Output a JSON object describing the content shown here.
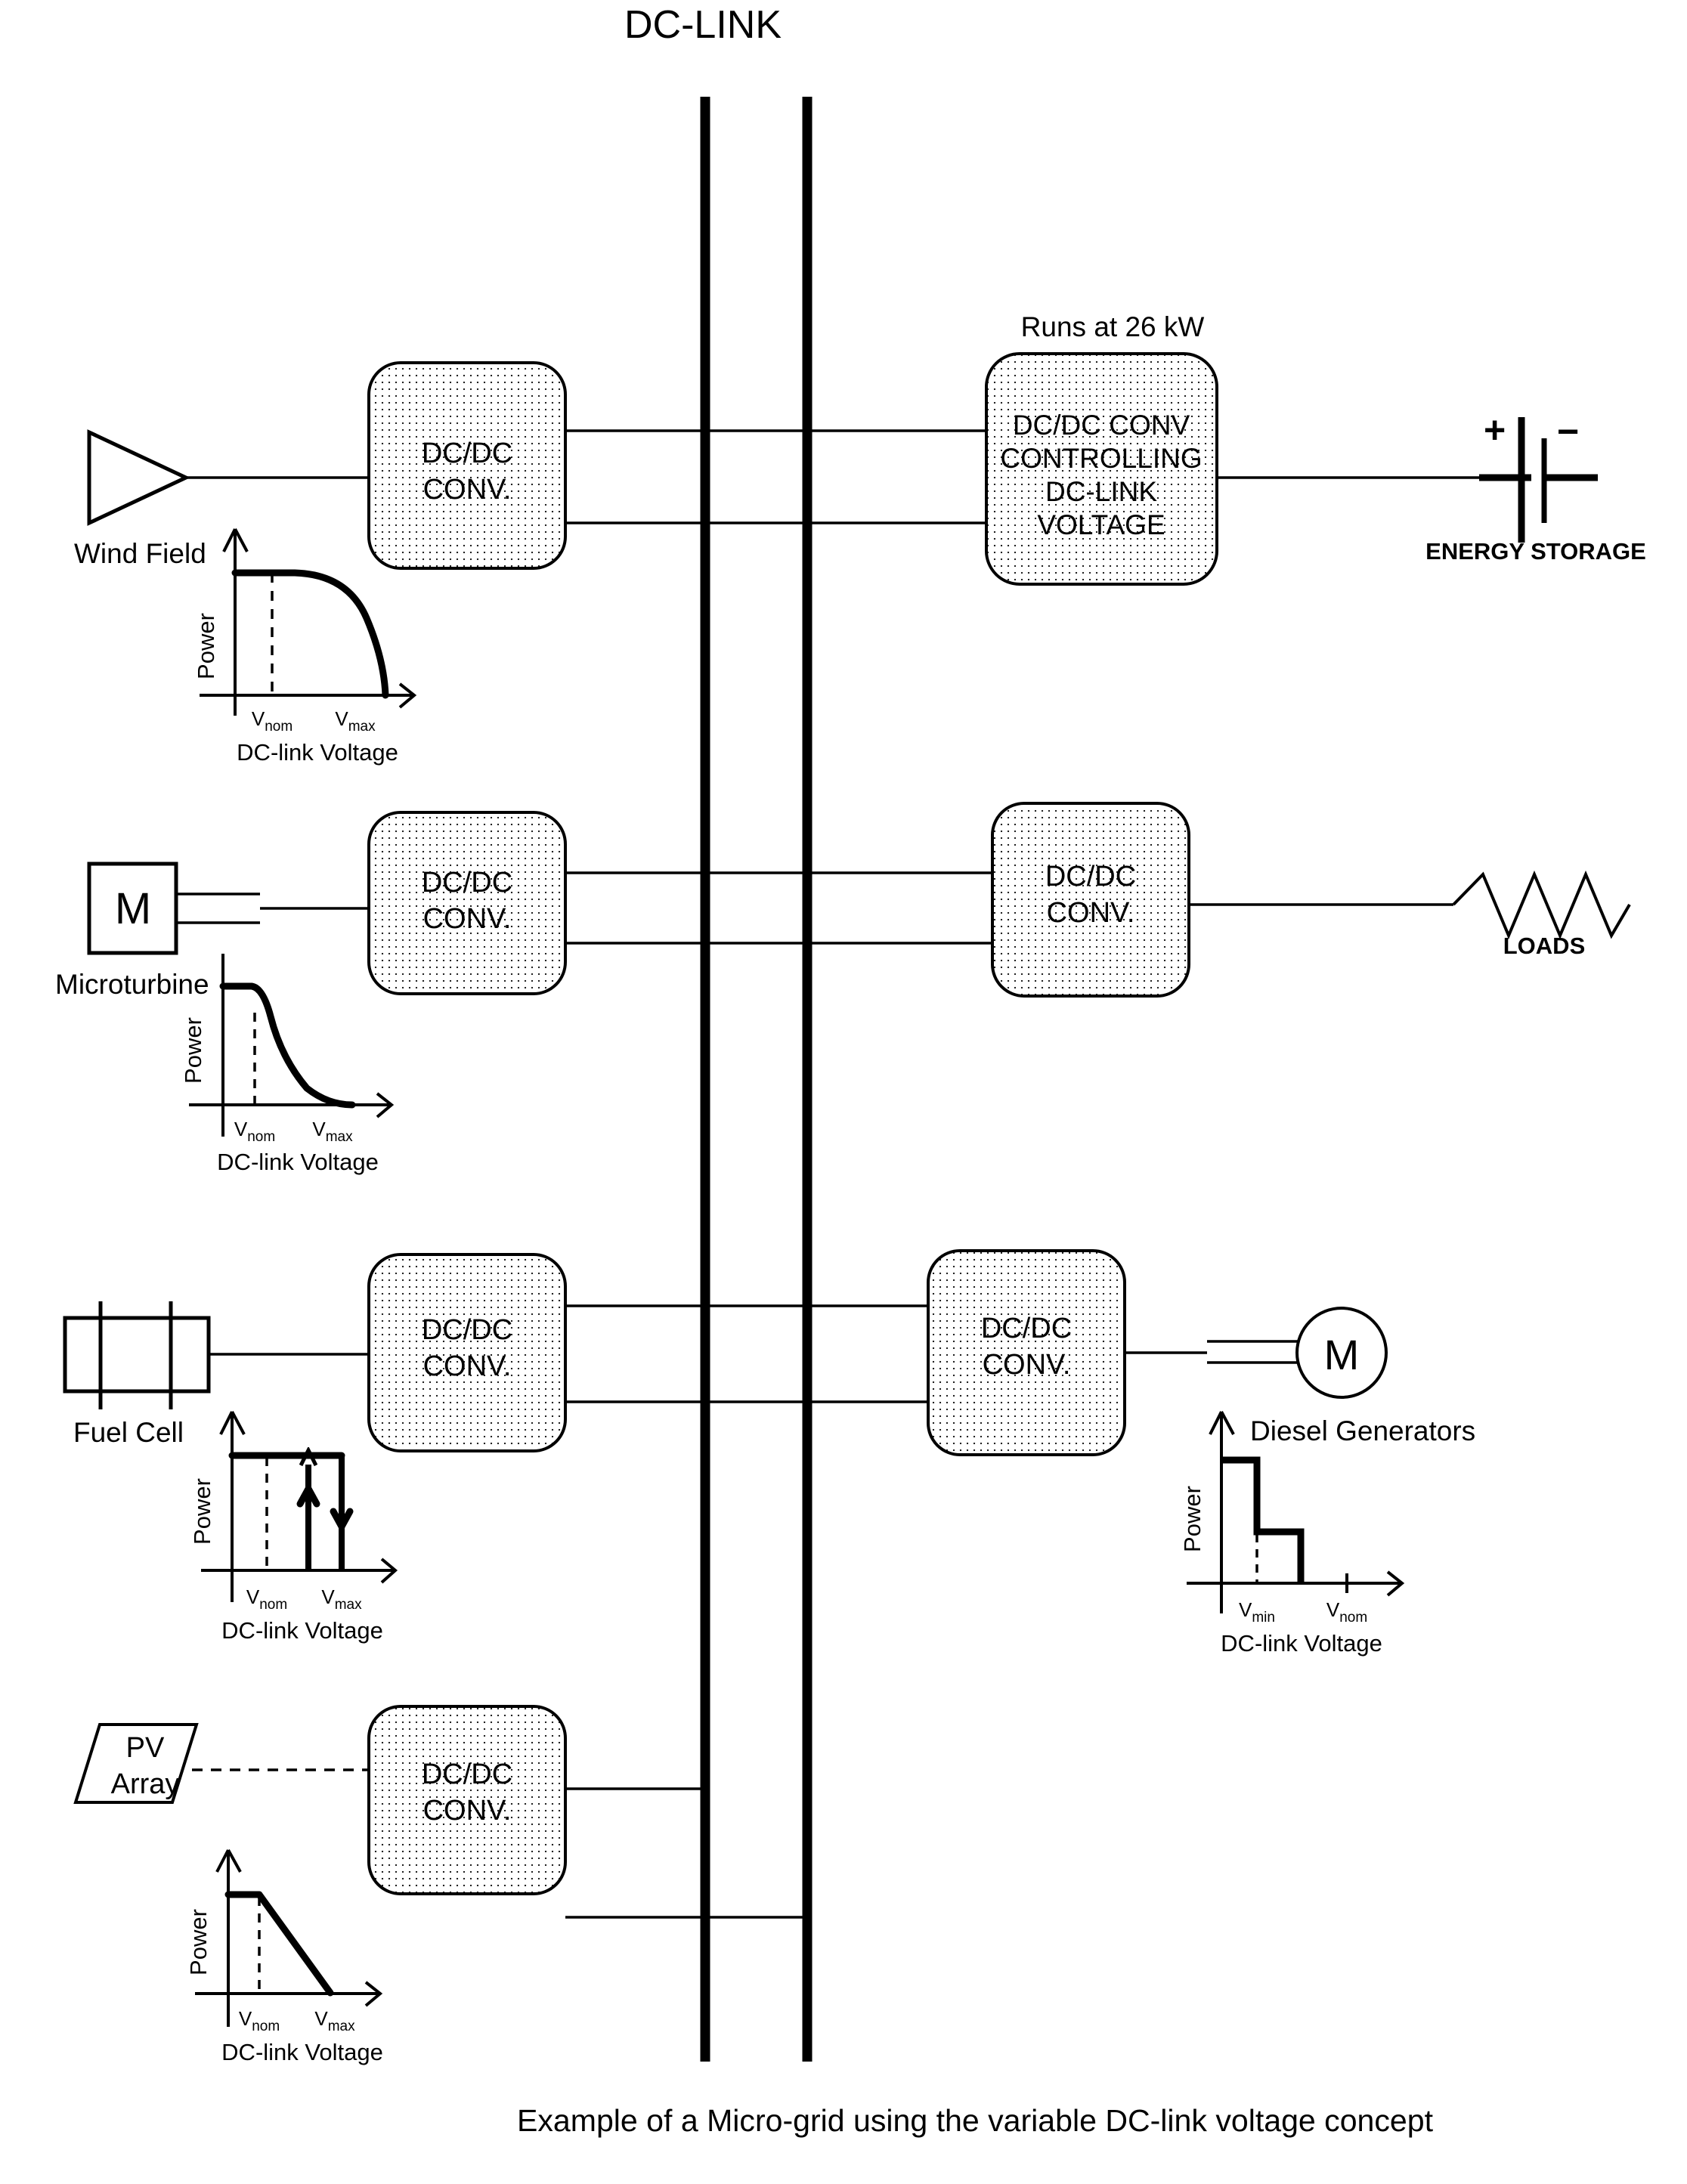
{
  "title": "DC-LINK",
  "caption": "Example of a Micro-grid using the variable DC-link voltage concept",
  "bus": {
    "name": "dc-link-bus",
    "bar_count": 2
  },
  "annotations": {
    "runs_at": "Runs at 26 kW"
  },
  "converters": {
    "standard_label_line1": "DC/DC",
    "standard_label_line2": "CONV.",
    "controller_line1": "DC/DC CONV",
    "controller_line2": "CONTROLLING",
    "controller_line3": "DC-LINK",
    "controller_line4": "VOLTAGE"
  },
  "sources": [
    {
      "id": "wind-field",
      "label": "Wind Field",
      "symbol": "triangle"
    },
    {
      "id": "microturbine",
      "label": "Microturbine",
      "symbol": "square-M",
      "symbol_text": "M"
    },
    {
      "id": "fuel-cell",
      "label": "Fuel Cell",
      "symbol": "fuel-cell-stack"
    },
    {
      "id": "pv-array",
      "label_line1": "PV",
      "label_line2": "Array",
      "symbol": "parallelogram"
    }
  ],
  "sinks": [
    {
      "id": "energy-storage",
      "label": "ENERGY STORAGE",
      "symbol": "battery",
      "plus": "+",
      "minus": "−"
    },
    {
      "id": "loads",
      "label": "LOADS",
      "symbol": "resistor"
    },
    {
      "id": "diesel-generators",
      "label": "Diesel Generators",
      "symbol": "circle-M",
      "symbol_text": "M"
    }
  ],
  "axis_labels": {
    "y": "Power",
    "x": "DC-link Voltage",
    "v_nom_prefix": "V",
    "v_nom_sub": "nom",
    "v_max_prefix": "V",
    "v_max_sub": "max",
    "v_min_prefix": "V",
    "v_min_sub": "min"
  },
  "chart_data": [
    {
      "id": "wind-field-power-curve",
      "type": "line",
      "title": "Wind Field power vs DC-link voltage",
      "xlabel": "DC-link Voltage",
      "ylabel": "Power",
      "xticks": [
        "V_nom",
        "V_max"
      ],
      "xtick_positions": [
        0.3,
        0.8
      ],
      "dashed_marker": "V_nom",
      "x": [
        0.0,
        0.15,
        0.3,
        0.4,
        0.5,
        0.58,
        0.66,
        0.72,
        0.77,
        0.8
      ],
      "y": [
        1.0,
        1.0,
        1.0,
        0.98,
        0.93,
        0.86,
        0.74,
        0.6,
        0.38,
        0.0
      ],
      "xlim": [
        0,
        1
      ],
      "ylim": [
        0,
        1.15
      ],
      "grid": false,
      "legend": "none",
      "description": "Flat at rated power until V_nom, then quarter-circle roll-off to zero at V_max"
    },
    {
      "id": "microturbine-power-curve",
      "type": "line",
      "title": "Microturbine power vs DC-link voltage",
      "xlabel": "DC-link Voltage",
      "ylabel": "Power",
      "xticks": [
        "V_nom",
        "V_max"
      ],
      "xtick_positions": [
        0.26,
        0.7
      ],
      "dashed_marker": "V_nom",
      "x": [
        0.0,
        0.18,
        0.22,
        0.26,
        0.31,
        0.38,
        0.46,
        0.55,
        0.64,
        0.72
      ],
      "y": [
        1.0,
        1.0,
        0.92,
        0.62,
        0.4,
        0.24,
        0.13,
        0.06,
        0.02,
        0.0
      ],
      "xlim": [
        0,
        1
      ],
      "ylim": [
        0,
        1.15
      ],
      "grid": false,
      "legend": "none",
      "description": "Flat at rated power then sharp exponential decay to near zero at V_max"
    },
    {
      "id": "fuel-cell-power-curve",
      "type": "line",
      "title": "Fuel Cell power vs DC-link voltage",
      "xlabel": "DC-link Voltage",
      "ylabel": "Power",
      "xticks": [
        "V_nom",
        "V_max"
      ],
      "xtick_positions": [
        0.28,
        0.68
      ],
      "dashed_marker": "V_nom",
      "x": [
        0.0,
        0.28,
        0.52,
        0.68
      ],
      "y": [
        1.0,
        1.0,
        1.0,
        1.0
      ],
      "xlim": [
        0,
        1
      ],
      "ylim": [
        0,
        1.15
      ],
      "grid": false,
      "legend": "none",
      "annotations": [
        "up-arrow at x=0.52 (turn-on)",
        "down-arrow at x=0.68 (turn-off at V_max)"
      ],
      "description": "Constant rated power with hysteretic on/off transitions shown as vertical arrows"
    },
    {
      "id": "diesel-generators-power-curve",
      "type": "line",
      "title": "Diesel Generators power vs DC-link voltage",
      "xlabel": "DC-link Voltage",
      "ylabel": "Power",
      "xticks": [
        "V_min",
        "V_nom"
      ],
      "xtick_positions": [
        0.22,
        0.68
      ],
      "dashed_marker": "V_min",
      "x": [
        0.0,
        0.18,
        0.18,
        0.45,
        0.45
      ],
      "y": [
        1.0,
        1.0,
        0.45,
        0.45,
        0.0
      ],
      "xlim": [
        0,
        1
      ],
      "ylim": [
        0,
        1.15
      ],
      "grid": false,
      "legend": "none",
      "description": "Descending staircase: full power below V_min, reduced step, then zero"
    },
    {
      "id": "pv-array-power-curve",
      "type": "line",
      "title": "PV Array power vs DC-link voltage",
      "xlabel": "DC-link Voltage",
      "ylabel": "Power",
      "xticks": [
        "V_nom",
        "V_max"
      ],
      "xtick_positions": [
        0.26,
        0.76
      ],
      "dashed_marker": "V_nom",
      "x": [
        0.0,
        0.22,
        0.76
      ],
      "y": [
        1.0,
        1.0,
        0.0
      ],
      "xlim": [
        0,
        1
      ],
      "ylim": [
        0,
        1.15
      ],
      "grid": false,
      "legend": "none",
      "description": "Flat at rated power until V_nom then linear ramp down to zero at V_max"
    }
  ],
  "colors": {
    "ink": "#000000",
    "paper": "#ffffff",
    "box_fill": "#fbfbfb"
  }
}
